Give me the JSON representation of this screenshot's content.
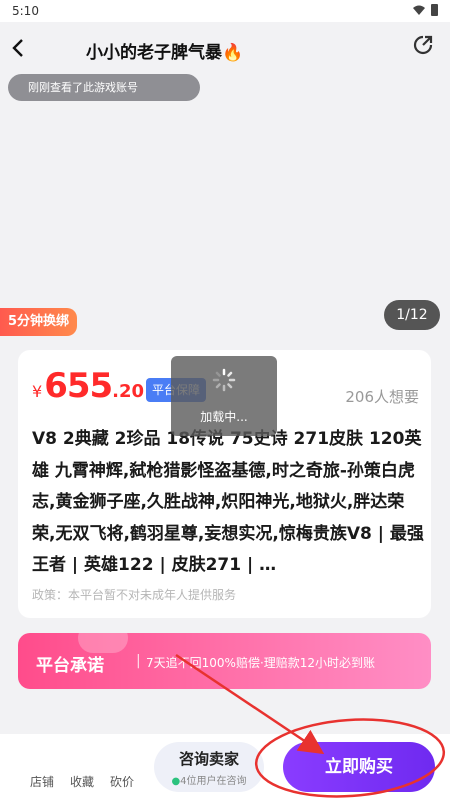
{
  "status_bar": {
    "time": "5:10"
  },
  "nav": {
    "title": "小小的老子脾气暴🔥"
  },
  "hero": {
    "recent_view_toast": "刚刚查看了此游戏账号",
    "bind_badge": "5分钟换绑",
    "page_counter": "1/12"
  },
  "listing": {
    "currency": "¥",
    "price_integer": "655",
    "price_decimal": ".20",
    "guarantee_tag": "平台保障",
    "wants": "206人想要",
    "description": "V8 2典藏 2珍品 18传说 75史诗 271皮肤 120英雄 九霄神辉,弑枪猎影怪盗基德,时之奇旅-孙策白虎志,黄金狮子座,久胜战神,炽阳神光,地狱火,胖达荣荣,无双飞将,鹤羽星尊,妄想实况,惊梅贵族V8 | 最强王者 | 英雄122 | 皮肤271 | …",
    "policy": "政策：本平台暂不对未成年人提供服务"
  },
  "loading": {
    "text": "加载中..."
  },
  "promise": {
    "title": "平台承诺",
    "separator": "|",
    "text": "7天追不回100%赔偿·理赔款12小时必到账"
  },
  "bottom_bar": {
    "shop": "店铺",
    "favorite": "收藏",
    "bargain": "砍价",
    "consult_label": "咨询卖家",
    "consult_dot": "●",
    "consult_sub": "4位用户在咨询",
    "buy_label": "立即购买"
  },
  "colors": {
    "price_red": "#ff2a2a",
    "buy_purple": "#7a32f5",
    "annotation_red": "#e8322f"
  }
}
